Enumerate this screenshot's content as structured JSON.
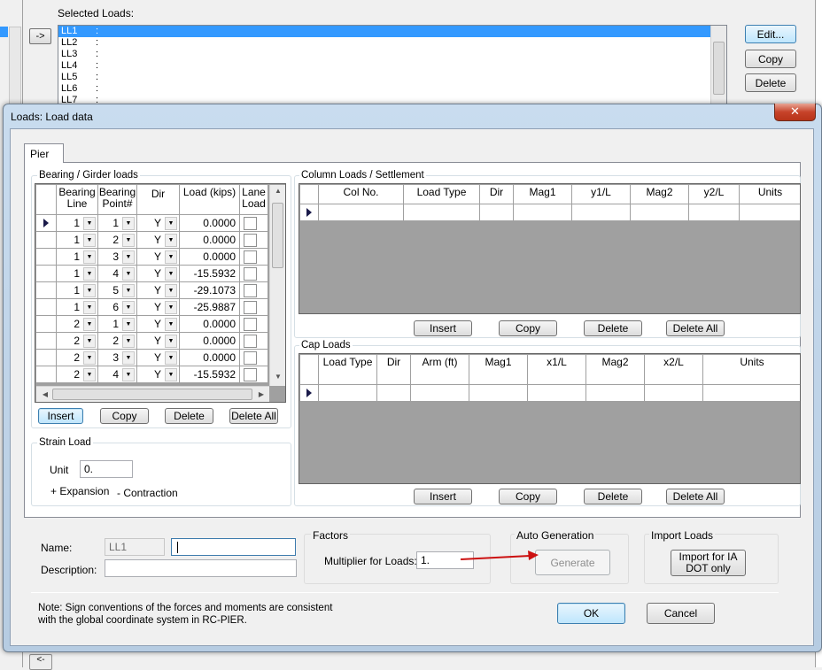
{
  "background": {
    "selected_loads_label": "Selected Loads:",
    "arrow_button": "->",
    "list_items": [
      "LL1",
      "LL2",
      "LL3",
      "LL4",
      "LL5",
      "LL6",
      "LL7"
    ],
    "colon": ":",
    "buttons": {
      "edit": "Edit...",
      "copy": "Copy",
      "delete": "Delete"
    },
    "bottom_button": "<-"
  },
  "dialog": {
    "title": "Loads: Load data",
    "close_glyph": "✕",
    "tab": "Pier",
    "bearing": {
      "title": "Bearing / Girder loads",
      "headers": [
        "Bearing Line",
        "Bearing Point#",
        "Dir",
        "Load (kips)",
        "Lane Load"
      ],
      "rows": [
        {
          "line": "1",
          "point": "1",
          "dir": "Y",
          "load": "0.0000"
        },
        {
          "line": "1",
          "point": "2",
          "dir": "Y",
          "load": "0.0000"
        },
        {
          "line": "1",
          "point": "3",
          "dir": "Y",
          "load": "0.0000"
        },
        {
          "line": "1",
          "point": "4",
          "dir": "Y",
          "load": "-15.5932"
        },
        {
          "line": "1",
          "point": "5",
          "dir": "Y",
          "load": "-29.1073"
        },
        {
          "line": "1",
          "point": "6",
          "dir": "Y",
          "load": "-25.9887"
        },
        {
          "line": "2",
          "point": "1",
          "dir": "Y",
          "load": "0.0000"
        },
        {
          "line": "2",
          "point": "2",
          "dir": "Y",
          "load": "0.0000"
        },
        {
          "line": "2",
          "point": "3",
          "dir": "Y",
          "load": "0.0000"
        },
        {
          "line": "2",
          "point": "4",
          "dir": "Y",
          "load": "-15.5932"
        }
      ],
      "buttons": {
        "insert": "Insert",
        "copy": "Copy",
        "delete": "Delete",
        "delete_all": "Delete All"
      }
    },
    "strain": {
      "title": "Strain Load",
      "unit_label": "Unit",
      "unit_value": "0.",
      "expansion": "+ Expansion",
      "contraction": "- Contraction"
    },
    "column": {
      "title": "Column Loads / Settlement",
      "headers": [
        "Col No.",
        "Load Type",
        "Dir",
        "Mag1",
        "y1/L",
        "Mag2",
        "y2/L",
        "Units"
      ],
      "buttons": {
        "insert": "Insert",
        "copy": "Copy",
        "delete": "Delete",
        "delete_all": "Delete All"
      }
    },
    "cap": {
      "title": "Cap Loads",
      "headers": [
        "Load Type",
        "Dir",
        "Arm (ft)",
        "Mag1",
        "x1/L",
        "Mag2",
        "x2/L",
        "Units"
      ],
      "buttons": {
        "insert": "Insert",
        "copy": "Copy",
        "delete": "Delete",
        "delete_all": "Delete All"
      }
    },
    "name_label": "Name:",
    "name_value": "LL1",
    "name_edit_value": "",
    "description_label": "Description:",
    "description_value": "",
    "factors": {
      "title": "Factors",
      "multiplier_label": "Multiplier for Loads:",
      "multiplier_value": "1."
    },
    "autogen": {
      "title": "Auto Generation",
      "generate": "Generate"
    },
    "import": {
      "title": "Import Loads",
      "button": "Import for IA DOT only"
    },
    "note": "Note: Sign conventions of the forces and moments are consistent with the global coordinate system in RC-PIER.",
    "ok": "OK",
    "cancel": "Cancel",
    "colors": {
      "selection": "#3399ff",
      "annotation_arrow": "#cc1111",
      "empty_grid": "#a0a0a0"
    }
  }
}
